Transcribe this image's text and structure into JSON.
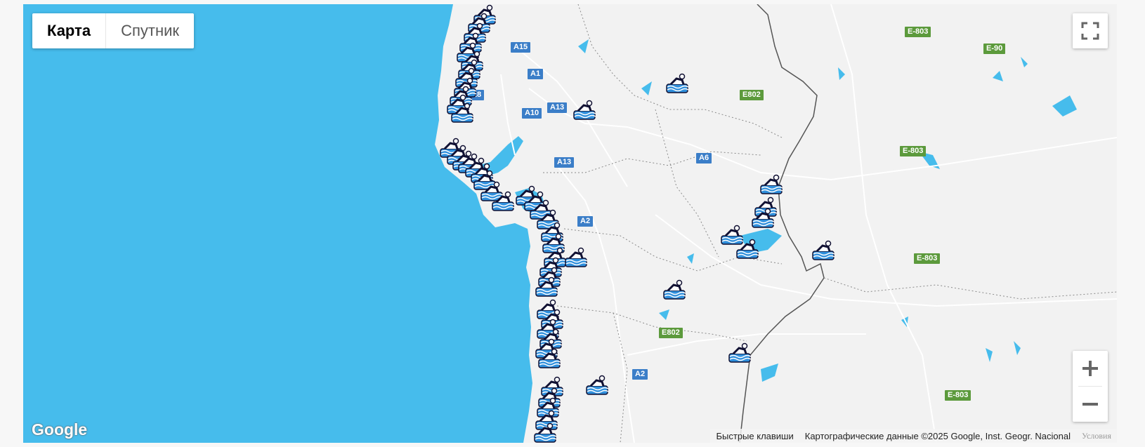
{
  "map_type": {
    "map_label": "Карта",
    "satellite_label": "Спутник",
    "selected": "Карта"
  },
  "controls": {
    "fullscreen_icon": "fullscreen-icon",
    "zoom_in_icon": "plus-icon",
    "zoom_out_icon": "minus-icon"
  },
  "branding": {
    "logo_text": "Google"
  },
  "footer": {
    "shortcuts": "Быстрые клавиши",
    "attribution": "Картографические данные ©2025 Google, Inst. Geogr. Nacional",
    "terms": "Условия"
  },
  "routes": {
    "A15": "A15",
    "A1": "A1",
    "A8": "A8",
    "A10": "A10",
    "A13": "A13",
    "A6": "A6",
    "A2": "A2",
    "E802": "E802",
    "E803": "E-803",
    "E90": "E-90"
  },
  "marker_icon": "swimmer-icon",
  "colors": {
    "water": "#46bcec",
    "land": "#f2f2f2",
    "route_blue": "#3b7ec8",
    "route_green": "#5c9a3c"
  }
}
